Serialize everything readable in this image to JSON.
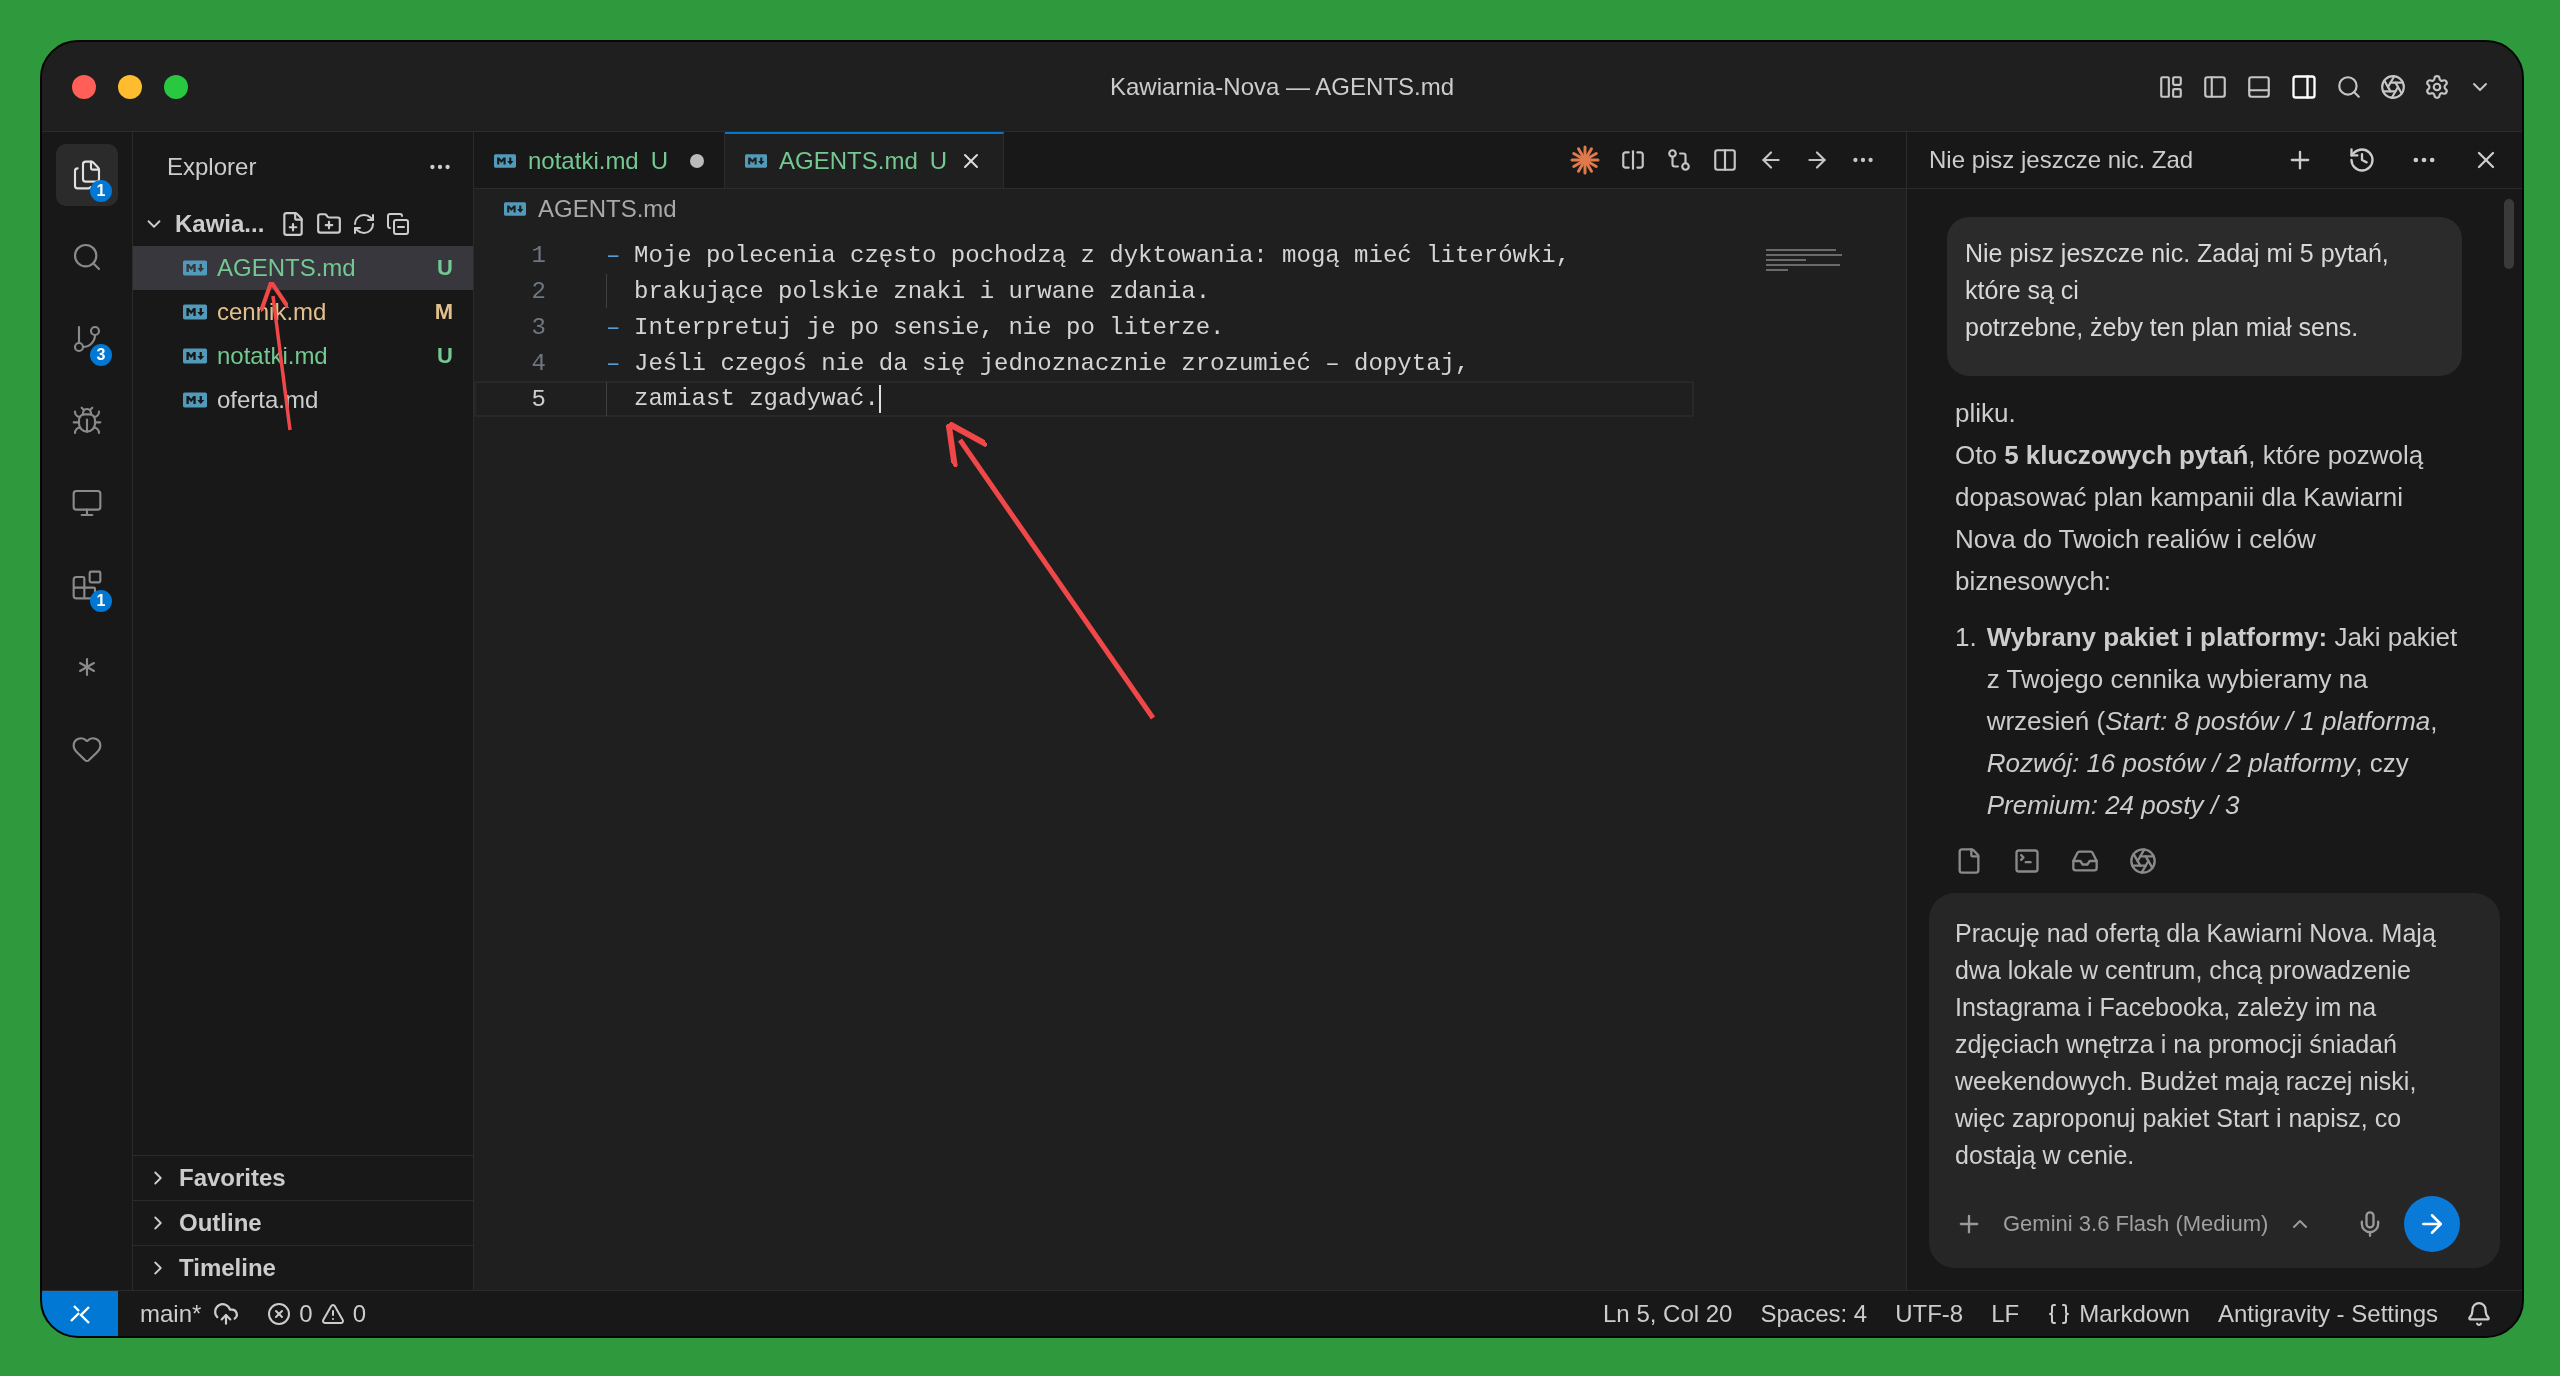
{
  "window": {
    "title": "Kawiarnia-Nova — AGENTS.md"
  },
  "activity_bar": [
    {
      "kind": "files",
      "badge": "1",
      "selected": true
    },
    {
      "kind": "search",
      "selected": false
    },
    {
      "kind": "source-control",
      "badge": "3",
      "selected": false
    },
    {
      "kind": "run-debug",
      "selected": false
    },
    {
      "kind": "remote",
      "selected": false
    },
    {
      "kind": "extensions",
      "badge": "1",
      "selected": false
    },
    {
      "kind": "asterisk",
      "selected": false
    },
    {
      "kind": "heart",
      "selected": false
    }
  ],
  "explorer": {
    "title": "Explorer",
    "folder": {
      "name": "Kawia...",
      "expanded": true
    },
    "files": [
      {
        "name": "AGENTS.md",
        "status": "U",
        "color": "#73c991",
        "selected": true
      },
      {
        "name": "cennik.md",
        "status": "M",
        "color": "#e2c08d",
        "selected": false
      },
      {
        "name": "notatki.md",
        "status": "U",
        "color": "#73c991",
        "selected": false
      },
      {
        "name": "oferta.md",
        "color": "#cccccc",
        "selected": false
      }
    ],
    "sections": [
      {
        "label": "Favorites",
        "expanded": false
      },
      {
        "label": "Outline",
        "expanded": false
      },
      {
        "label": "Timeline",
        "expanded": false
      }
    ]
  },
  "tabs": [
    {
      "label": "notatki.md",
      "status": "U",
      "dirty": true,
      "selected": false
    },
    {
      "label": "AGENTS.md",
      "status": "U",
      "dirty": false,
      "selected": true
    }
  ],
  "breadcrumb": "AGENTS.md",
  "code_lines": [
    {
      "number": "1",
      "kind": "bullet",
      "marker": "–",
      "text": "Moje polecenia często pochodzą z dyktowania: mogą mieć literówki,",
      "current": false
    },
    {
      "number": "2",
      "kind": "continuation",
      "text": "brakujące polskie znaki i urwane zdania.",
      "current": false
    },
    {
      "number": "3",
      "kind": "bullet",
      "marker": "–",
      "text": "Interpretuj je po sensie, nie po literze.",
      "current": false
    },
    {
      "number": "4",
      "kind": "bullet",
      "marker": "–",
      "text": "Jeśli czegoś nie da się jednoznacznie zrozumieć – dopytaj,",
      "current": false
    },
    {
      "number": "5",
      "kind": "continuation",
      "text": "zamiast zgadywać.",
      "current": true
    }
  ],
  "chat": {
    "title": "Nie pisz jeszcze nic. Zad",
    "user_message": "Nie pisz jeszcze nic. Zadaj mi 5 pytań, które są ci\npotrzebne, żeby ten plan miał sens.",
    "paragraphs": [
      "pliku.",
      "Oto **5 kluczowych pytań**, które pozwolą dopasować plan kampanii dla Kawiarni Nova do Twoich realiów i celów biznesowych:"
    ],
    "list": [
      {
        "number": "1.",
        "text": "**Wybrany pakiet i platformy:** Jaki pakiet z Twojego cennika wybieramy na wrzesień (*Start: 8 postów / 1 platforma*, *Rozwój: 16 postów / 2 platformy*, czy *Premium: 24 posty / 3*"
      }
    ],
    "composer_text": "Pracuję nad ofertą dla Kawiarni Nova. Mają dwa lokale w centrum, chcą prowadzenie Instagrama i Facebooka, zależy im na zdjęciach wnętrza i na promocji śniadań  weekendowych. Budżet mają raczej niski, więc zaproponuj pakiet Start i napisz, co dostają w cenie.",
    "model": "Gemini 3.6 Flash (Medium)"
  },
  "status_bar": {
    "branch": "main*",
    "errors": "0",
    "warnings": "0",
    "right": [
      {
        "kind": "text",
        "text": "Ln 5, Col 20"
      },
      {
        "kind": "text",
        "text": "Spaces: 4"
      },
      {
        "kind": "text",
        "text": "UTF-8"
      },
      {
        "kind": "text",
        "text": "LF"
      },
      {
        "kind": "language",
        "text": "Markdown"
      },
      {
        "kind": "text",
        "text": "Antigravity - Settings"
      }
    ]
  }
}
